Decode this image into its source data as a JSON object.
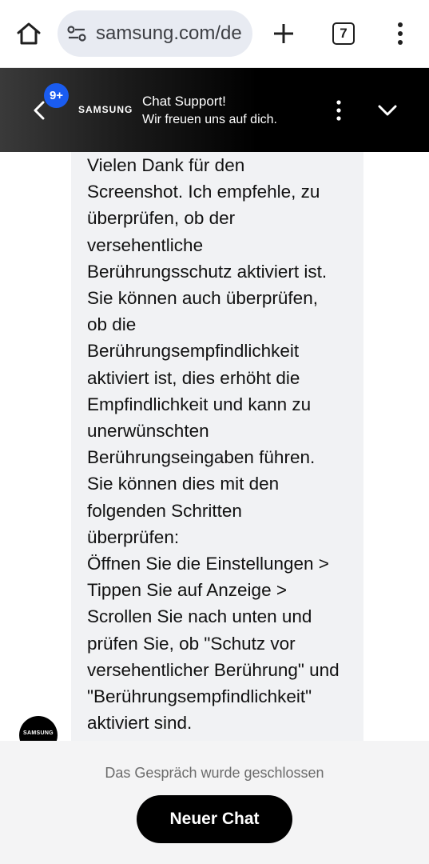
{
  "browser": {
    "url": "samsung.com/de",
    "tab_count": "7",
    "icons": [
      "home-icon",
      "site-settings-icon",
      "plus-icon",
      "tabs-icon",
      "more-vert-icon"
    ]
  },
  "chat_header": {
    "notification_badge": "9+",
    "brand": "SAMSUNG",
    "title": "Chat Support!",
    "subtitle": "Wir freuen uns auf dich.",
    "icons": [
      "back-chevron-icon",
      "kebab-icon",
      "chevron-down-icon"
    ]
  },
  "message": {
    "text": "Vielen Dank für den\nScreenshot. Ich empfehle, zu\nüberprüfen, ob der\nversehentliche\nBerührungsschutz aktiviert ist.\nSie können auch überprüfen,\nob die\nBerührungsempfindlichkeit\naktiviert ist, dies erhöht die\nEmpfindlichkeit und kann zu\nunerwünschten\nBerührungseingaben führen.\nSie können dies mit den\nfolgenden Schritten\nüberprüfen:\nÖffnen Sie die Einstellungen >\nTippen Sie auf Anzeige >\nScrollen Sie nach unten und\nprüfen Sie, ob \"Schutz vor\nversehentlicher Berührung\" und\n\"Berührungsempfindlichkeit\"\naktiviert sind.",
    "avatar_label": "SAMSUNG"
  },
  "footer": {
    "status": "Das Gespräch wurde geschlossen",
    "new_chat_label": "Neuer Chat"
  },
  "colors": {
    "badge": "#1a5cf0",
    "header_bg": "#000000",
    "bubble_bg": "#f1f2f4",
    "footer_bg": "#f4f4f5"
  }
}
